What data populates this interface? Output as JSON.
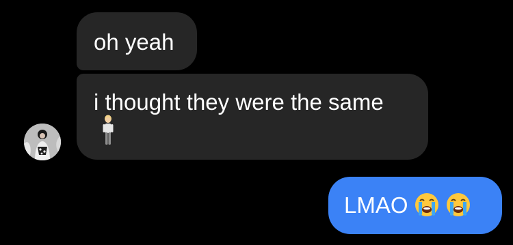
{
  "messages": [
    {
      "text": "oh yeah",
      "direction": "incoming"
    },
    {
      "text": "i thought they were the same",
      "trailing_icon": "standing-person-icon",
      "direction": "incoming"
    },
    {
      "text": "LMAO",
      "emojis": [
        "loudly-crying-face-icon",
        "loudly-crying-face-icon"
      ],
      "direction": "outgoing"
    }
  ],
  "colors": {
    "background": "#000000",
    "incoming_bubble": "#262626",
    "outgoing_bubble": "#3b82f6",
    "text": "#ffffff"
  },
  "avatar": {
    "icon": "profile-avatar"
  }
}
